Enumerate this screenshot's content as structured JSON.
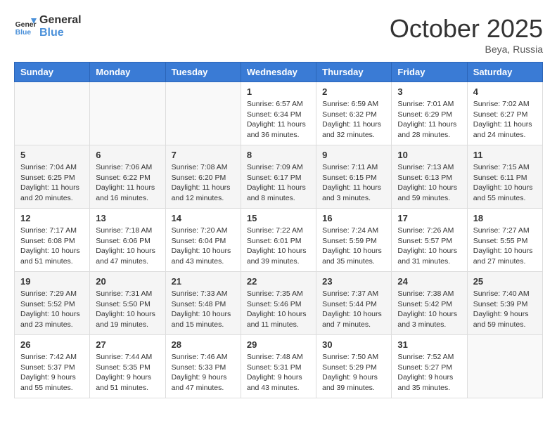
{
  "header": {
    "logo_line1": "General",
    "logo_line2": "Blue",
    "month": "October 2025",
    "location": "Beya, Russia"
  },
  "weekdays": [
    "Sunday",
    "Monday",
    "Tuesday",
    "Wednesday",
    "Thursday",
    "Friday",
    "Saturday"
  ],
  "weeks": [
    [
      {
        "day": "",
        "info": ""
      },
      {
        "day": "",
        "info": ""
      },
      {
        "day": "",
        "info": ""
      },
      {
        "day": "1",
        "info": "Sunrise: 6:57 AM\nSunset: 6:34 PM\nDaylight: 11 hours\nand 36 minutes."
      },
      {
        "day": "2",
        "info": "Sunrise: 6:59 AM\nSunset: 6:32 PM\nDaylight: 11 hours\nand 32 minutes."
      },
      {
        "day": "3",
        "info": "Sunrise: 7:01 AM\nSunset: 6:29 PM\nDaylight: 11 hours\nand 28 minutes."
      },
      {
        "day": "4",
        "info": "Sunrise: 7:02 AM\nSunset: 6:27 PM\nDaylight: 11 hours\nand 24 minutes."
      }
    ],
    [
      {
        "day": "5",
        "info": "Sunrise: 7:04 AM\nSunset: 6:25 PM\nDaylight: 11 hours\nand 20 minutes."
      },
      {
        "day": "6",
        "info": "Sunrise: 7:06 AM\nSunset: 6:22 PM\nDaylight: 11 hours\nand 16 minutes."
      },
      {
        "day": "7",
        "info": "Sunrise: 7:08 AM\nSunset: 6:20 PM\nDaylight: 11 hours\nand 12 minutes."
      },
      {
        "day": "8",
        "info": "Sunrise: 7:09 AM\nSunset: 6:17 PM\nDaylight: 11 hours\nand 8 minutes."
      },
      {
        "day": "9",
        "info": "Sunrise: 7:11 AM\nSunset: 6:15 PM\nDaylight: 11 hours\nand 3 minutes."
      },
      {
        "day": "10",
        "info": "Sunrise: 7:13 AM\nSunset: 6:13 PM\nDaylight: 10 hours\nand 59 minutes."
      },
      {
        "day": "11",
        "info": "Sunrise: 7:15 AM\nSunset: 6:11 PM\nDaylight: 10 hours\nand 55 minutes."
      }
    ],
    [
      {
        "day": "12",
        "info": "Sunrise: 7:17 AM\nSunset: 6:08 PM\nDaylight: 10 hours\nand 51 minutes."
      },
      {
        "day": "13",
        "info": "Sunrise: 7:18 AM\nSunset: 6:06 PM\nDaylight: 10 hours\nand 47 minutes."
      },
      {
        "day": "14",
        "info": "Sunrise: 7:20 AM\nSunset: 6:04 PM\nDaylight: 10 hours\nand 43 minutes."
      },
      {
        "day": "15",
        "info": "Sunrise: 7:22 AM\nSunset: 6:01 PM\nDaylight: 10 hours\nand 39 minutes."
      },
      {
        "day": "16",
        "info": "Sunrise: 7:24 AM\nSunset: 5:59 PM\nDaylight: 10 hours\nand 35 minutes."
      },
      {
        "day": "17",
        "info": "Sunrise: 7:26 AM\nSunset: 5:57 PM\nDaylight: 10 hours\nand 31 minutes."
      },
      {
        "day": "18",
        "info": "Sunrise: 7:27 AM\nSunset: 5:55 PM\nDaylight: 10 hours\nand 27 minutes."
      }
    ],
    [
      {
        "day": "19",
        "info": "Sunrise: 7:29 AM\nSunset: 5:52 PM\nDaylight: 10 hours\nand 23 minutes."
      },
      {
        "day": "20",
        "info": "Sunrise: 7:31 AM\nSunset: 5:50 PM\nDaylight: 10 hours\nand 19 minutes."
      },
      {
        "day": "21",
        "info": "Sunrise: 7:33 AM\nSunset: 5:48 PM\nDaylight: 10 hours\nand 15 minutes."
      },
      {
        "day": "22",
        "info": "Sunrise: 7:35 AM\nSunset: 5:46 PM\nDaylight: 10 hours\nand 11 minutes."
      },
      {
        "day": "23",
        "info": "Sunrise: 7:37 AM\nSunset: 5:44 PM\nDaylight: 10 hours\nand 7 minutes."
      },
      {
        "day": "24",
        "info": "Sunrise: 7:38 AM\nSunset: 5:42 PM\nDaylight: 10 hours\nand 3 minutes."
      },
      {
        "day": "25",
        "info": "Sunrise: 7:40 AM\nSunset: 5:39 PM\nDaylight: 9 hours\nand 59 minutes."
      }
    ],
    [
      {
        "day": "26",
        "info": "Sunrise: 7:42 AM\nSunset: 5:37 PM\nDaylight: 9 hours\nand 55 minutes."
      },
      {
        "day": "27",
        "info": "Sunrise: 7:44 AM\nSunset: 5:35 PM\nDaylight: 9 hours\nand 51 minutes."
      },
      {
        "day": "28",
        "info": "Sunrise: 7:46 AM\nSunset: 5:33 PM\nDaylight: 9 hours\nand 47 minutes."
      },
      {
        "day": "29",
        "info": "Sunrise: 7:48 AM\nSunset: 5:31 PM\nDaylight: 9 hours\nand 43 minutes."
      },
      {
        "day": "30",
        "info": "Sunrise: 7:50 AM\nSunset: 5:29 PM\nDaylight: 9 hours\nand 39 minutes."
      },
      {
        "day": "31",
        "info": "Sunrise: 7:52 AM\nSunset: 5:27 PM\nDaylight: 9 hours\nand 35 minutes."
      },
      {
        "day": "",
        "info": ""
      }
    ]
  ]
}
